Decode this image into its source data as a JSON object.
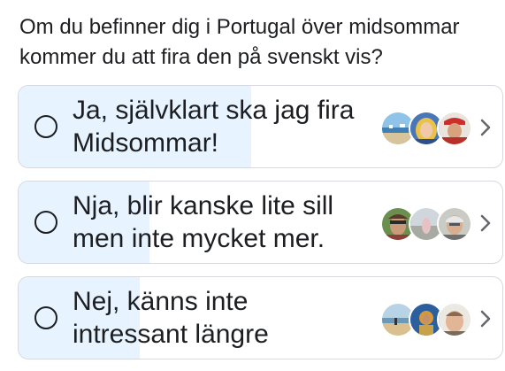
{
  "question": {
    "line1": "Om du befinner dig i Portugal över midsommar",
    "line2": "kommer du att fira den på svenskt vis?"
  },
  "options": [
    {
      "line1": "Ja, självklart ska jag fira",
      "line2": "Midsommar!",
      "vote_share": 0.48,
      "voter_avatars": [
        "beach-photo",
        "blonde-woman-photo",
        "man-with-cap-photo"
      ]
    },
    {
      "line1": "Nja, blir kanske lite sill",
      "line2": "men inte mycket mer.",
      "vote_share": 0.27,
      "voter_avatars": [
        "woman-with-sunglasses-photo",
        "landscape-photo",
        "grey-haired-man-photo"
      ]
    },
    {
      "line1": "Nej, känns inte",
      "line2": "intressant längre",
      "vote_share": 0.25,
      "voter_avatars": [
        "beach-photo",
        "figure-on-blue-photo",
        "man-portrait-photo"
      ]
    }
  ],
  "colors": {
    "result_fill": "#e7f3ff",
    "border": "#d6d9dd",
    "text": "#1c1e21",
    "chevron": "#65676b"
  },
  "icons": {
    "radio": "radio-unselected-icon",
    "chevron": "chevron-right-icon"
  }
}
